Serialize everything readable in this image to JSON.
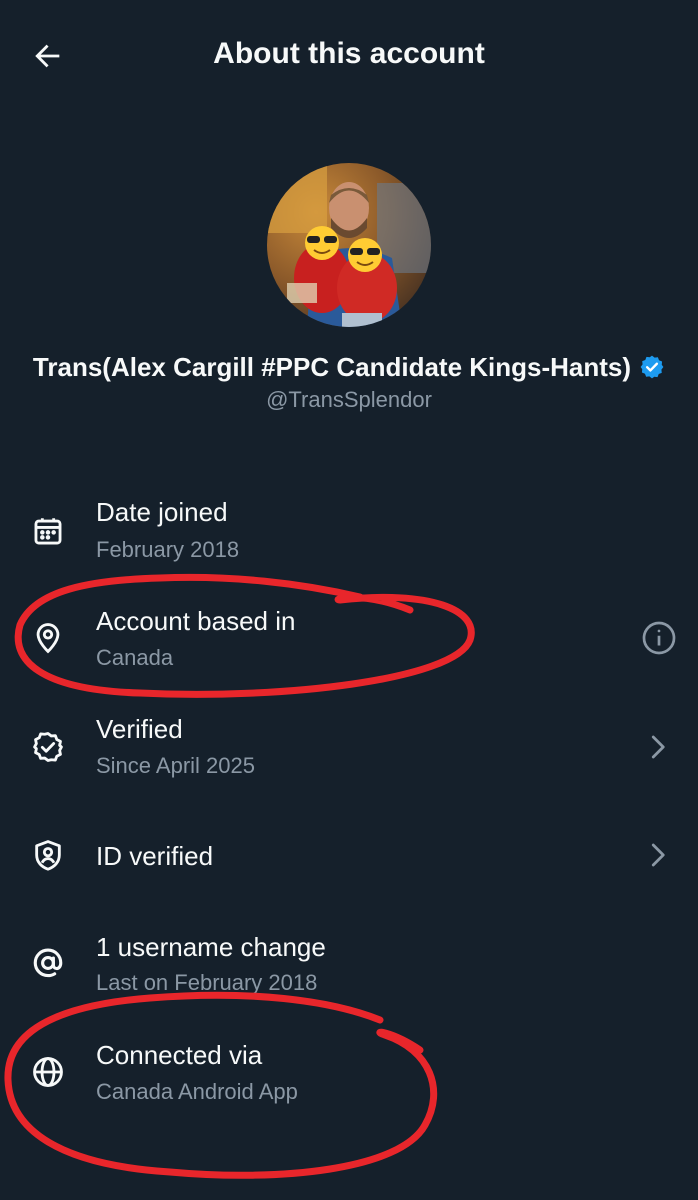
{
  "header": {
    "title": "About this account",
    "back_icon": "arrow-left-icon"
  },
  "profile": {
    "display_name": "Trans(Alex Cargill #PPC Candidate Kings-Hants)",
    "handle": "@TransSplendor",
    "verified": true,
    "badge_color": "#1d9bf0"
  },
  "rows": [
    {
      "icon": "calendar-icon",
      "title": "Date joined",
      "subtitle": "February 2018",
      "trailing": null
    },
    {
      "icon": "location-pin-icon",
      "title": "Account based in",
      "subtitle": "Canada",
      "trailing": "info-icon"
    },
    {
      "icon": "verified-check-icon",
      "title": "Verified",
      "subtitle": "Since April 2025",
      "trailing": "chevron-right-icon"
    },
    {
      "icon": "shield-user-icon",
      "title": "ID verified",
      "subtitle": "",
      "trailing": "chevron-right-icon"
    },
    {
      "icon": "at-sign-icon",
      "title": "1 username change",
      "subtitle": "Last on February 2018",
      "trailing": null
    },
    {
      "icon": "globe-icon",
      "title": "Connected via",
      "subtitle": "Canada Android App",
      "trailing": null
    }
  ],
  "annotation_color": "#e8262b",
  "colors": {
    "background": "#15202b",
    "text_primary": "#f7f9f9",
    "text_secondary": "#8b98a5"
  }
}
